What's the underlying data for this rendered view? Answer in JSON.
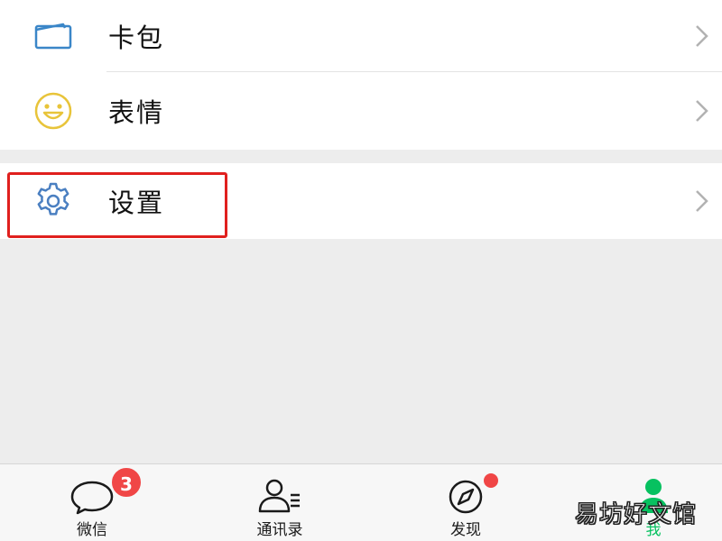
{
  "menu": {
    "card_pack": {
      "label": "卡包",
      "icon": "card-wallet-icon"
    },
    "stickers": {
      "label": "表情",
      "icon": "smiley-icon"
    },
    "settings": {
      "label": "设置",
      "icon": "gear-icon"
    }
  },
  "tabbar": {
    "chats": {
      "label": "微信",
      "icon": "chat-bubble-icon",
      "badge": "3"
    },
    "contacts": {
      "label": "通讯录",
      "icon": "contacts-icon"
    },
    "discover": {
      "label": "发现",
      "icon": "compass-icon",
      "has_dot": true
    },
    "me": {
      "label": "我",
      "icon": "person-icon",
      "active": true
    }
  },
  "watermark": "易坊好文馆",
  "colors": {
    "accent_green": "#07c160",
    "highlight_red": "#e0201e",
    "badge_red": "#f04646",
    "card_icon_blue": "#3a86c8",
    "smiley_yellow": "#e8c43a",
    "gear_blue": "#4a7fc1"
  }
}
